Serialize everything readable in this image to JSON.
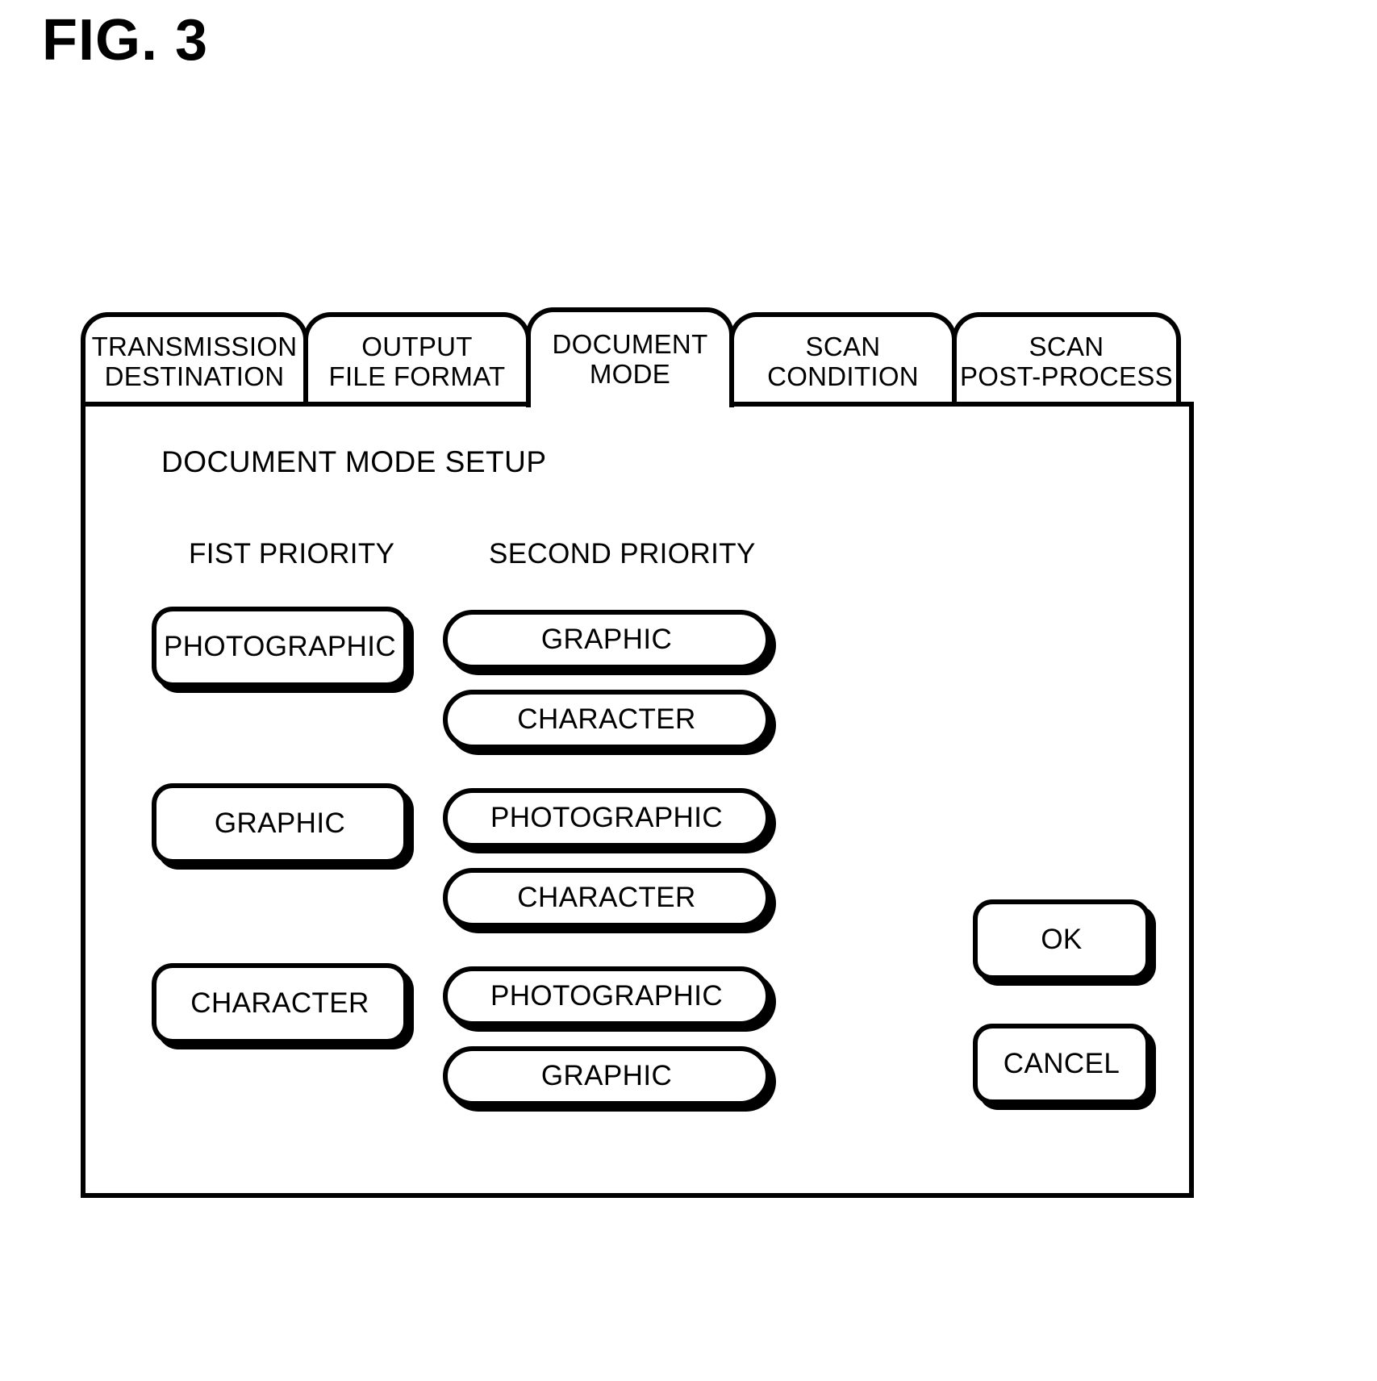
{
  "figure": {
    "title": "FIG. 3"
  },
  "dialog": {
    "tabs": [
      {
        "name": "transmission-destination",
        "line1": "TRANSMISSION",
        "line2": "DESTINATION",
        "active": false
      },
      {
        "name": "output-file-format",
        "line1": "OUTPUT",
        "line2": "FILE FORMAT",
        "active": false
      },
      {
        "name": "document-mode",
        "line1": "DOCUMENT",
        "line2": "MODE",
        "active": true
      },
      {
        "name": "scan-condition",
        "line1": "SCAN",
        "line2": "CONDITION",
        "active": false
      },
      {
        "name": "scan-post-process",
        "line1": "SCAN",
        "line2": "POST-PROCESS",
        "active": false
      }
    ],
    "panel": {
      "heading": "DOCUMENT MODE SETUP",
      "columns": {
        "first_priority_label": "FIST PRIORITY",
        "second_priority_label": "SECOND PRIORITY"
      },
      "groups": [
        {
          "first": "PHOTOGRAPHIC",
          "second": [
            "GRAPHIC",
            "CHARACTER"
          ]
        },
        {
          "first": "GRAPHIC",
          "second": [
            "PHOTOGRAPHIC",
            "CHARACTER"
          ]
        },
        {
          "first": "CHARACTER",
          "second": [
            "PHOTOGRAPHIC",
            "GRAPHIC"
          ]
        }
      ],
      "actions": {
        "ok": "OK",
        "cancel": "CANCEL"
      }
    }
  },
  "colors": {
    "ink": "#000000",
    "paper": "#ffffff"
  }
}
